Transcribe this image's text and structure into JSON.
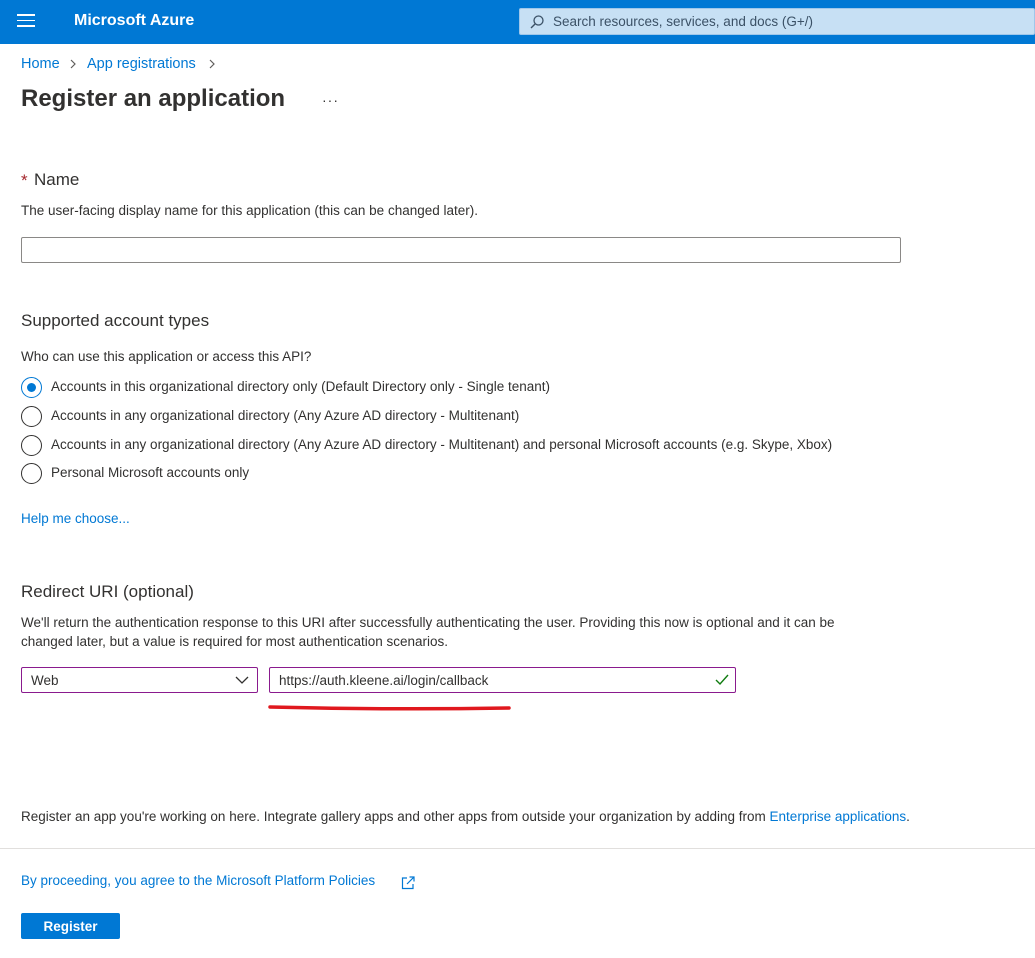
{
  "header": {
    "brand": "Microsoft Azure",
    "search_placeholder": "Search resources, services, and docs (G+/)"
  },
  "breadcrumb": {
    "home": "Home",
    "app_registrations": "App registrations"
  },
  "page": {
    "title": "Register an application",
    "more": "···"
  },
  "name_section": {
    "required_marker": "*",
    "label": "Name",
    "description": "The user-facing display name for this application (this can be changed later).",
    "value": ""
  },
  "account_types": {
    "heading": "Supported account types",
    "question": "Who can use this application or access this API?",
    "options": [
      {
        "label": "Accounts in this organizational directory only (Default Directory only - Single tenant)",
        "selected": true
      },
      {
        "label": "Accounts in any organizational directory (Any Azure AD directory - Multitenant)",
        "selected": false
      },
      {
        "label": "Accounts in any organizational directory (Any Azure AD directory - Multitenant) and personal Microsoft accounts (e.g. Skype, Xbox)",
        "selected": false
      },
      {
        "label": "Personal Microsoft accounts only",
        "selected": false
      }
    ],
    "help_link": "Help me choose..."
  },
  "redirect": {
    "heading": "Redirect URI (optional)",
    "desc_line1": "We'll return the authentication response to this URI after successfully authenticating the user. Providing this now is optional and it can be",
    "desc_line2": "changed later, but a value is required for most authentication scenarios.",
    "platform": "Web",
    "uri": "https://auth.kleene.ai/login/callback"
  },
  "footer": {
    "note": "Register an app you're working on here. Integrate gallery apps and other apps from outside your organization by adding from",
    "enterprise_link": "Enterprise applications",
    "period": ".",
    "policies_link": "By proceeding, you agree to the Microsoft Platform Policies",
    "register_button": "Register"
  },
  "colors": {
    "accent": "#0078d4",
    "header_bg": "#0078d4",
    "input_focus_border": "#8a1a8e",
    "valid_check": "#107c10",
    "annotation_underline": "#e0181e",
    "required": "#a4262c"
  }
}
